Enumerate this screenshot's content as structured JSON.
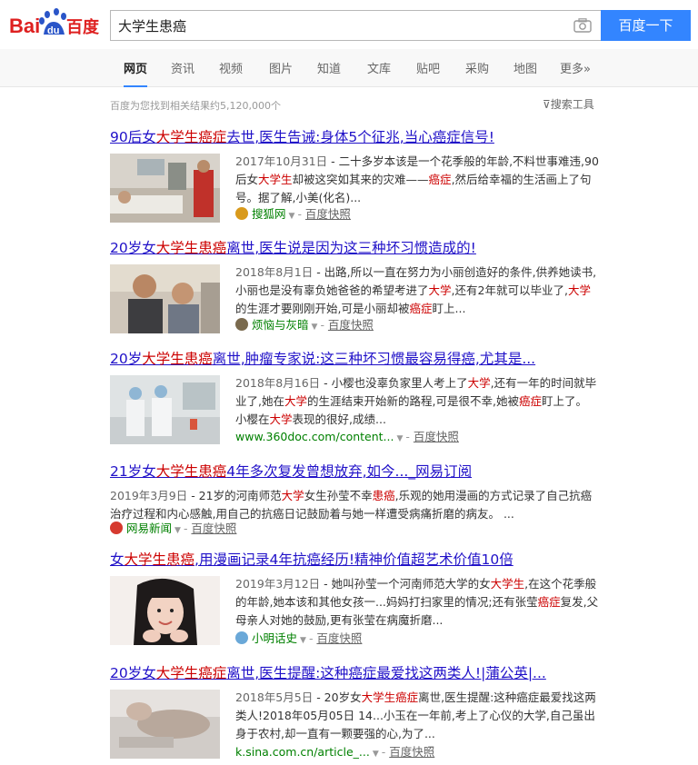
{
  "header": {
    "logo_text_left": "Bai",
    "logo_text_du": "du",
    "logo_text_right": "百度",
    "query": "大学生患癌",
    "search_button": "百度一下"
  },
  "tabs": [
    "网页",
    "资讯",
    "视频",
    "图片",
    "知道",
    "文库",
    "贴吧",
    "采购",
    "地图",
    "更多»"
  ],
  "stats": "百度为您找到相关结果约5,120,000个",
  "tools": "搜索工具",
  "snapshot_label": "百度快照",
  "results": [
    {
      "title_a": "90后女",
      "title_em": "大学生癌症",
      "title_b": "去世,医生告诫:身体5个征兆,当心癌症信号!",
      "date": "2017年10月31日",
      "body_a": " - 二十多岁本该是一个花季般的年龄,不料世事难违,90后女",
      "body_em1": "大学生",
      "body_b": "却被这突如其来的灾难——",
      "body_em2": "癌症",
      "body_c": ",然后给幸福的生活画上了句号。据了解,小美(化名)...",
      "source": "搜狐网",
      "icon_color": "#d99a1c"
    },
    {
      "title_a": "20岁女",
      "title_em": "大学生患癌",
      "title_b": "离世,医生说是因为这三种坏习惯造成的!",
      "date": "2018年8月1日",
      "body_a": " - 出路,所以一直在努力为小丽创造好的条件,供养她读书,小丽也是没有辜负她爸爸的希望考进了",
      "body_em1": "大学",
      "body_b": ",还有2年就可以毕业了,",
      "body_em2": "大学",
      "body_c": "的生涯才要刚刚开始,可是小丽却被",
      "body_em3": "癌症",
      "body_d": "盯上...",
      "source": "烦恼与灰暗",
      "icon_color": "#7a6a4e"
    },
    {
      "title_a": "20岁",
      "title_em": "大学生患癌",
      "title_b": "离世,肿瘤专家说:这三种坏习惯最容易得癌,尤其是...",
      "date": "2018年8月16日",
      "body_a": " - 小樱也没辜负家里人考上了",
      "body_em1": "大学",
      "body_b": ",还有一年的时间就毕业了,她在",
      "body_em2": "大学",
      "body_c": "的生涯结束开始新的路程,可是很不幸,她被",
      "body_em3": "癌症",
      "body_d": "盯上了。 小樱在",
      "body_em4": "大学",
      "body_e": "表现的很好,成绩...",
      "source": "www.360doc.com/content...",
      "icon_color": ""
    },
    {
      "title_a": "21岁女",
      "title_em": "大学生患癌",
      "title_b": "4年多次复发曾想放弃,如今..._网易订阅",
      "date": "2019年3月9日",
      "body_a": " - 21岁的河南师范",
      "body_em1": "大学",
      "body_b": "女生孙莹不幸",
      "body_em2": "患癌",
      "body_c": ",乐观的她用漫画的方式记录了自己抗癌治疗过程和内心感触,用自己的抗癌日记鼓励着与她一样遭受病痛折磨的病友。 ...",
      "source": "网易新闻",
      "icon_color": "#d63a2f"
    },
    {
      "title_a": "女",
      "title_em": "大学生患癌",
      "title_b": ",用漫画记录4年抗癌经历!精神价值超艺术价值10倍",
      "date": "2019年3月12日",
      "body_a": " - 她叫孙莹一个河南师范大学的女",
      "body_em1": "大学生",
      "body_b": ",在这个花季般的年龄,她本该和其他女孩一...妈妈打扫家里的情况;还有张莹",
      "body_em2": "癌症",
      "body_c": "复发,父母亲人对她的鼓励,更有张莹在病魔折磨...",
      "source": "小明话史",
      "icon_color": "#6aa8d8"
    },
    {
      "title_a": "20岁女",
      "title_em": "大学生癌症",
      "title_b": "离世,医生提醒:这种癌症最爱找这两类人!|蒲公英|...",
      "date": "2018年5月5日",
      "body_a": " - 20岁女",
      "body_em1": "大学生癌症",
      "body_b": "离世,医生提醒:这种癌症最爱找这两类人!2018年05月05日 14...小玉在一年前,考上了心仪的大学,自己虽出身于农村,却一直有一颗要强的心,为了...",
      "source": "k.sina.com.cn/article_...",
      "icon_color": ""
    }
  ],
  "colors": {
    "accent": "#3385ff",
    "title_link": "#2011c8",
    "highlight": "#c00000",
    "source_green": "#008000"
  }
}
